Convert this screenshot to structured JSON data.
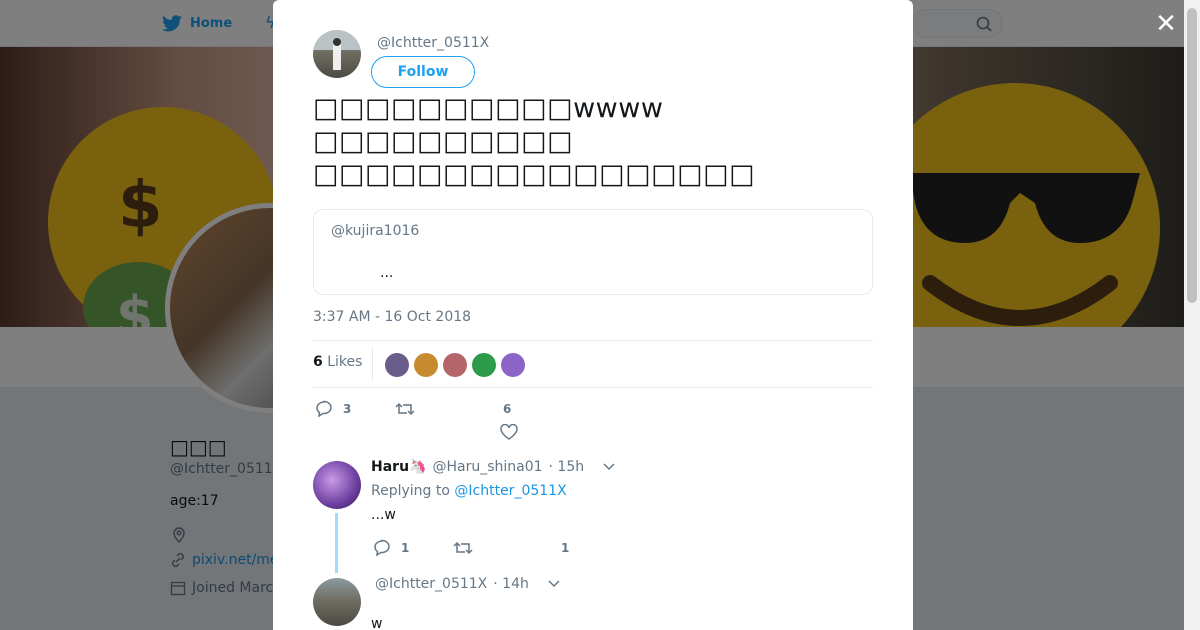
{
  "nav": {
    "home_label": "Home"
  },
  "profile": {
    "name": "□□□",
    "handle": "@Ichtter_0511",
    "bio": "age:17",
    "link": "pixiv.net/me",
    "joined": "Joined Marc"
  },
  "tweet": {
    "handle": "@Ichtter_0511X",
    "follow_label": "Follow",
    "lines": [
      "□□□□□□□□□□wwww",
      "□□□□□□□□□□",
      "□□□□□□□□□□□□□□□□□"
    ],
    "quote": {
      "handle": "@kujira1016",
      "text": "..."
    },
    "time": "3:37 AM - 16 Oct 2018",
    "likes_count": "6",
    "likes_label": "Likes",
    "liker_colors": [
      "#6a5d8c",
      "#c78b2f",
      "#b5656a",
      "#2e9b4a",
      "#8c64c8"
    ],
    "reply_count": "3",
    "like_count_action": "6"
  },
  "replies": [
    {
      "name": "Haru🦄",
      "handle": "@Haru_shina01",
      "time": "· 15h",
      "replying_prefix": "Replying to",
      "replying_to": "@Ichtter_0511X",
      "text": "...w",
      "reply_count": "1",
      "like_count": "1"
    },
    {
      "name": "",
      "handle": "@Ichtter_0511X",
      "time": "· 14h",
      "text": "w"
    }
  ],
  "colors": {
    "accent": "#1da1f2",
    "thread_line": "#a3d9fb"
  }
}
